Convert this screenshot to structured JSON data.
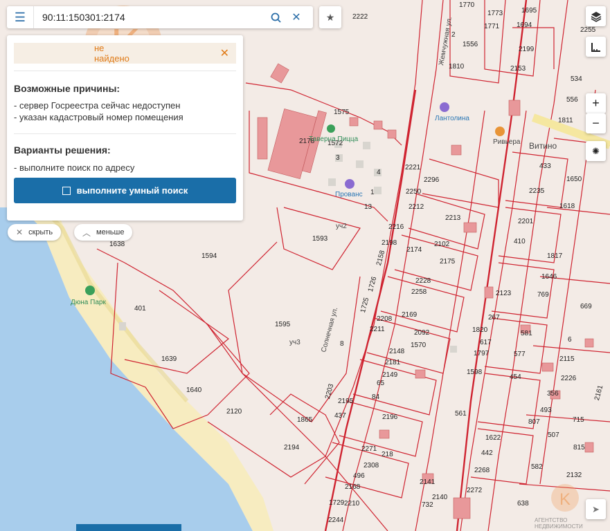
{
  "search": {
    "value": "90:11:150301:2174"
  },
  "panel": {
    "not_found": "не найдено",
    "reasons_title": "Возможные причины:",
    "reasons": [
      "- сервер Госреестра сейчас недоступен",
      "- указан кадастровый номер помещения"
    ],
    "solutions_title": "Варианты решения:",
    "solutions": [
      "- выполните поиск по адресу"
    ],
    "smart_search_label": "выполните умный поиск"
  },
  "pills": {
    "hide": "скрыть",
    "less": "меньше"
  },
  "watermark": {
    "text": "АГЕНТСТВО НЕДВИЖИМОСТИ",
    "small": "АГЕНТСТВО НЕДВИЖИМОСТИ"
  },
  "map": {
    "pois": [
      "Дюна Парк",
      "Прованс",
      "Таверна Пицца",
      "Ривьера",
      "Витино",
      "Лантолина"
    ],
    "streets": [
      "Солнечная ул.",
      "Жемчужная ул.",
      "уч2",
      "уч3"
    ],
    "parcels": [
      "2222",
      "1770",
      "1773",
      "1695",
      "1771",
      "1694",
      "2255",
      "1556",
      "2199",
      "1810",
      "2153",
      "534",
      "1811",
      "556",
      "433",
      "2235",
      "1618",
      "1650",
      "1817",
      "1646",
      "2201",
      "410",
      "1593",
      "1594",
      "1595",
      "401",
      "1639",
      "1640",
      "2120",
      "1865",
      "2194",
      "2123",
      "2115",
      "2226",
      "356",
      "493",
      "715",
      "807",
      "507",
      "815",
      "582",
      "638",
      "2132",
      "1638",
      "2178",
      "1572",
      "1575",
      "2221",
      "2296",
      "2250",
      "2212",
      "2213",
      "2216",
      "2198",
      "2174",
      "2102",
      "2175",
      "2228",
      "2258",
      "2208",
      "2211",
      "2169",
      "2092",
      "2148",
      "1570",
      "2181",
      "2149",
      "65",
      "84",
      "2195",
      "437",
      "2196",
      "2203",
      "1725",
      "1726",
      "2158",
      "267",
      "1820",
      "617",
      "1797",
      "581",
      "577",
      "454",
      "1598",
      "1622",
      "2268",
      "2271",
      "218",
      "2308",
      "496",
      "2168",
      "2141",
      "2140",
      "2272",
      "1729",
      "2210",
      "2244",
      "732",
      "2161",
      "669",
      "769",
      "6",
      "561",
      "442",
      "3",
      "4",
      "1",
      "13",
      "2",
      "8"
    ],
    "accent": "#cf2330"
  },
  "controls": {
    "layers_icon": "layers-icon",
    "ruler_icon": "ruler-icon",
    "zoom_in": "+",
    "zoom_out": "−",
    "locate_icon": "locate-icon",
    "navigate_icon": "navigate-icon"
  }
}
